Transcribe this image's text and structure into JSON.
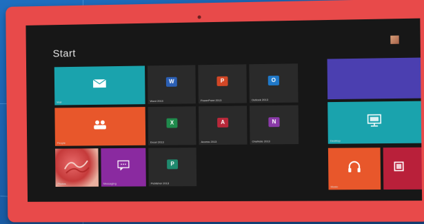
{
  "start": {
    "title": "Start"
  },
  "user": {
    "name": ""
  },
  "colors": {
    "frame": "#e84a4a",
    "screen": "#171717",
    "teal": "#1aa3ad",
    "orange": "#e8572b",
    "purple": "#8a2aa0",
    "dark_tile": "#2a2a2a",
    "blue_tile": "#4b3fb0"
  },
  "tiles": {
    "mail": {
      "label": "Mail",
      "icon": "mail-icon"
    },
    "word": {
      "label": "Word 2013",
      "icon": "word-icon"
    },
    "powerpoint": {
      "label": "PowerPoint 2013",
      "icon": "powerpoint-icon"
    },
    "outlook": {
      "label": "Outlook 2013",
      "icon": "outlook-icon"
    },
    "people": {
      "label": "People",
      "icon": "people-icon"
    },
    "excel": {
      "label": "Excel 2013",
      "icon": "excel-icon"
    },
    "access": {
      "label": "Access 2013",
      "icon": "access-icon"
    },
    "onenote": {
      "label": "OneNote 2013",
      "icon": "onenote-icon"
    },
    "photos": {
      "label": "Photos",
      "icon": "photo-icon"
    },
    "messaging": {
      "label": "Messaging",
      "icon": "messaging-icon"
    },
    "publisher": {
      "label": "Publisher 2013",
      "icon": "publisher-icon"
    },
    "calendar": {
      "label": "",
      "line1": "",
      "line2": "",
      "icon": "calendar-icon"
    },
    "desktop": {
      "label": "Desktop",
      "icon": "desktop-icon"
    },
    "music": {
      "label": "Music",
      "icon": "headphones-icon"
    },
    "video": {
      "label": "",
      "icon": "video-icon"
    }
  }
}
